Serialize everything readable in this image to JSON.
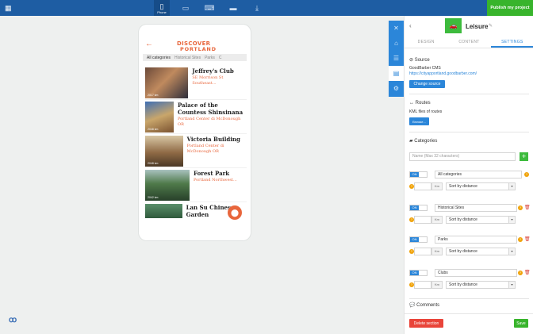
{
  "topbar": {
    "menu_icon": "grid-icon",
    "devices": [
      {
        "icon": "phone-icon",
        "label": "Phone",
        "active": true
      },
      {
        "icon": "tablet-icon",
        "label": "",
        "active": false
      },
      {
        "icon": "laptop-icon",
        "label": "",
        "active": false
      },
      {
        "icon": "desktop-icon",
        "label": "",
        "active": false
      },
      {
        "icon": "download-icon",
        "label": "",
        "active": false
      }
    ],
    "publish_label": "Publish my project",
    "publish_color": "#38b42c",
    "bar_color": "#1e5da3"
  },
  "preview": {
    "logo_line1": "DISCOVER",
    "logo_line2": "PORTLAND",
    "categories": [
      "All categories",
      "Historical Sites",
      "Parks",
      "C"
    ],
    "items": [
      {
        "title": "Jeffrey's Club",
        "address": "SE Morrison St Southeast...",
        "distance": "2017 km"
      },
      {
        "title": "Palace of the Countess Shinsinana",
        "address": "Portland Center di McDonough OR",
        "distance": "2048 km"
      },
      {
        "title": "Victoria Building",
        "address": "Portland Center di McDonough OR",
        "distance": "2048 km"
      },
      {
        "title": "Forest Park",
        "address": "Portland Northwest...",
        "distance": "2042 km"
      },
      {
        "title": "Lan Su Chinese Garden",
        "address": "",
        "distance": ""
      }
    ],
    "accent_color": "#e8663c"
  },
  "rail": {
    "icons": [
      "close-icon",
      "layout-icon",
      "document-icon",
      "settings-icon"
    ]
  },
  "panel": {
    "title": "Leisure",
    "tabs": [
      "DESIGN",
      "CONTENT",
      "SETTINGS"
    ],
    "active_tab": "SETTINGS",
    "source": {
      "heading": "Source",
      "cms": "GoodBarber CMS",
      "url": "https://cityapportland.goodbarber.com/",
      "button": "Change source"
    },
    "routes": {
      "heading": "Routes",
      "text": "KML files of routes",
      "button": "Browse..."
    },
    "categories": {
      "heading": "Categories",
      "name_placeholder": "Name (Max 32 characters)",
      "items": [
        {
          "toggle": "ON",
          "name": "All categories",
          "unit": "Km",
          "sort": "Sort by distance"
        },
        {
          "toggle": "ON",
          "name": "Historical Sites",
          "unit": "Km",
          "sort": "Sort by distance"
        },
        {
          "toggle": "ON",
          "name": "Parks",
          "unit": "Km",
          "sort": "Sort by distance"
        },
        {
          "toggle": "ON",
          "name": "Clubs",
          "unit": "Km",
          "sort": "Sort by distance"
        }
      ]
    },
    "comments_heading": "Comments",
    "delete_label": "Delete section",
    "save_label": "Save"
  }
}
